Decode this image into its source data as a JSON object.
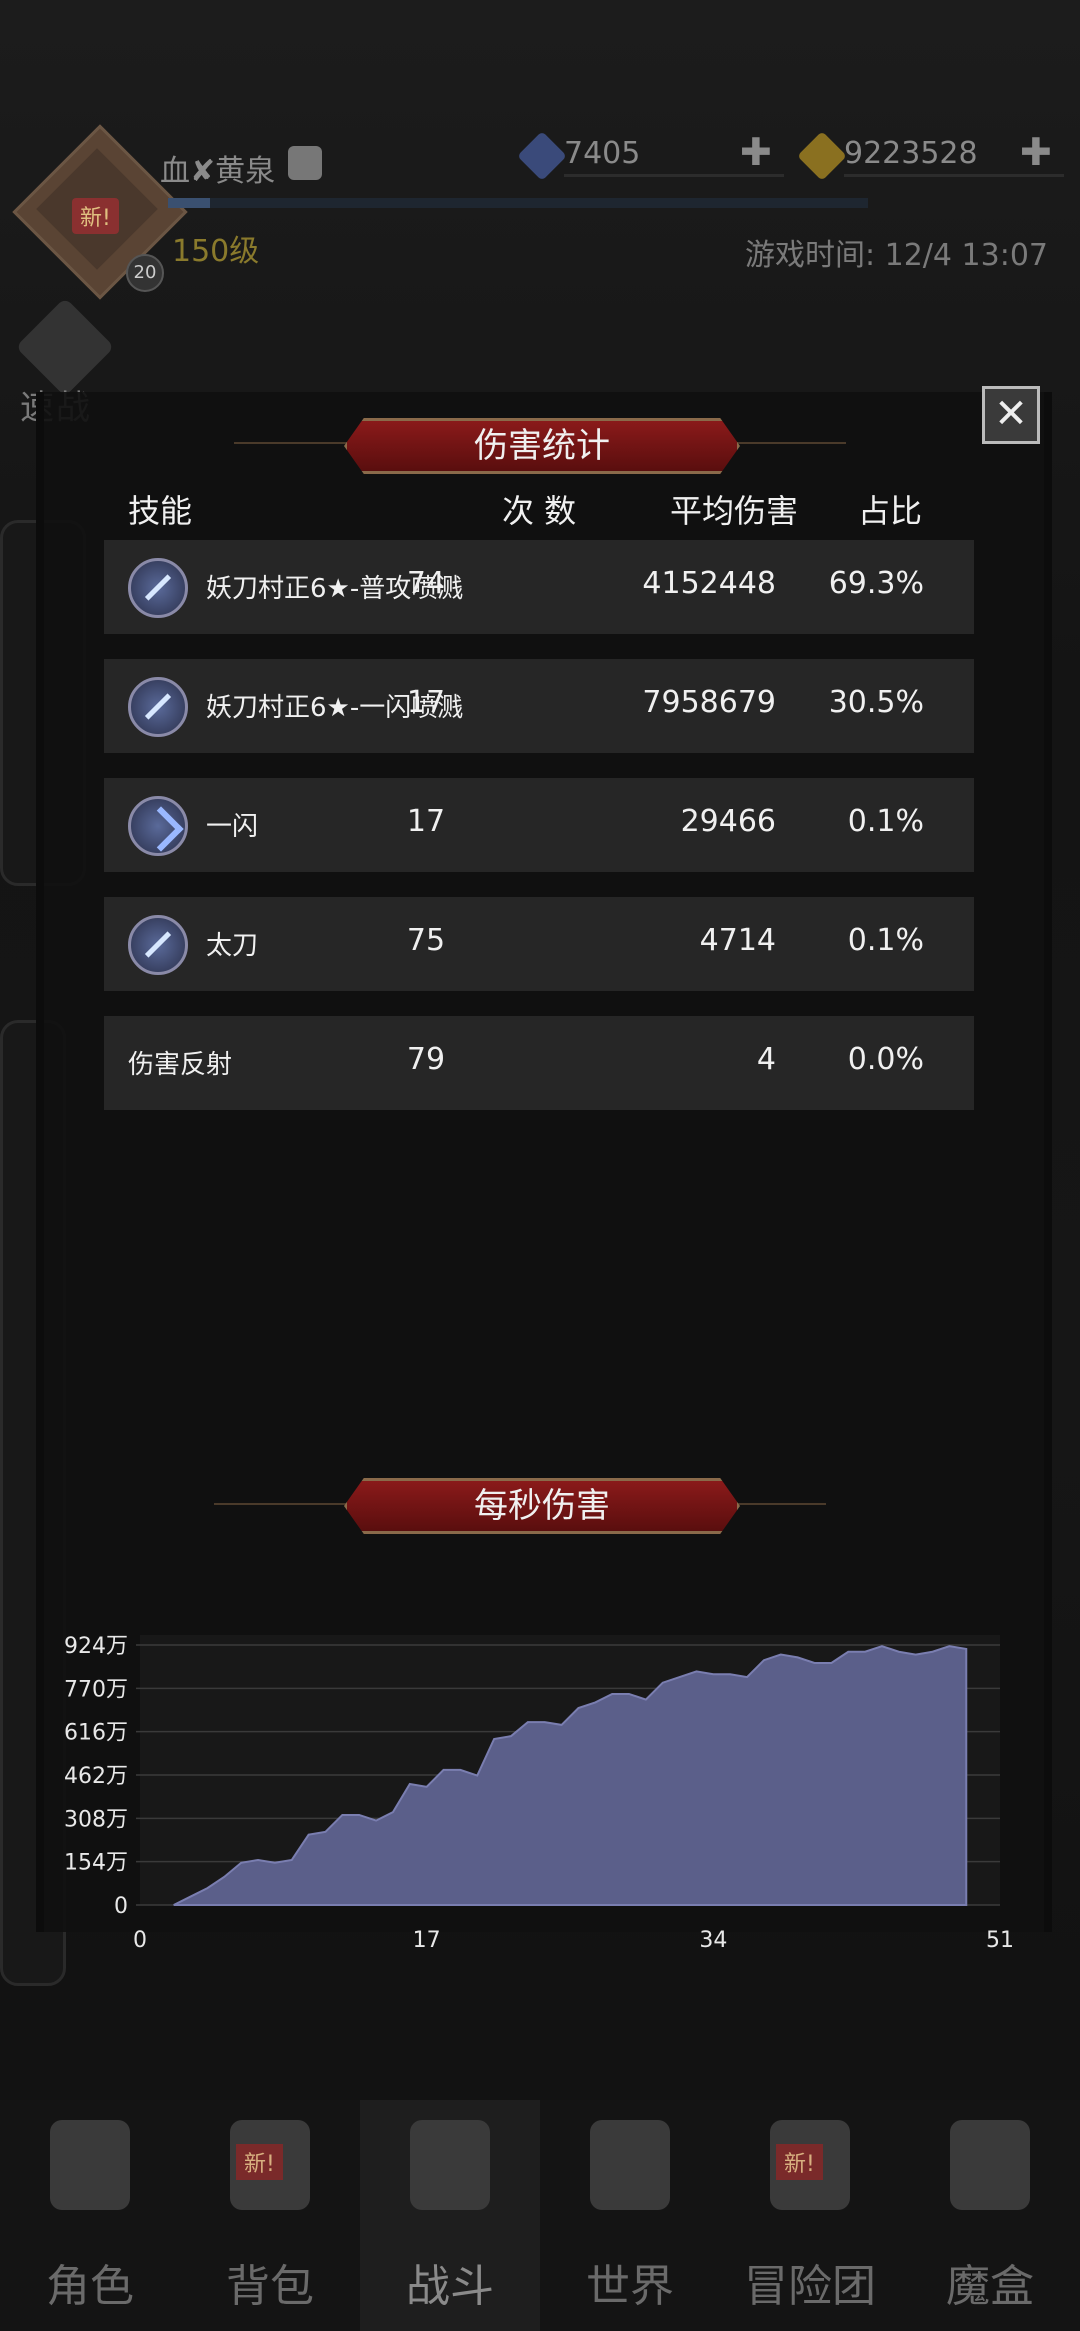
{
  "player": {
    "name": "血✘黄泉",
    "level": "150级",
    "avatar_badge": "新!",
    "avatar_level": "20",
    "exp_progress": 0.06
  },
  "resources": {
    "gems": "7405",
    "gold": "9223528"
  },
  "game_time": "游戏时间: 12/4 13:07",
  "quick_battle_label": "速战",
  "damage_stats": {
    "title": "伤害统计",
    "headers": {
      "skill": "技能",
      "count": "次 数",
      "avg": "平均伤害",
      "ratio": "占比"
    },
    "rows": [
      {
        "icon": "sword-icon",
        "name": "妖刀村正6★-普攻喷溅",
        "count": "74",
        "avg": "4152448",
        "ratio": "69.3%"
      },
      {
        "icon": "sword-icon",
        "name": "妖刀村正6★-一闪喷溅",
        "count": "17",
        "avg": "7958679",
        "ratio": "30.5%"
      },
      {
        "icon": "flash-icon",
        "name": "一闪",
        "count": "17",
        "avg": "29466",
        "ratio": "0.1%"
      },
      {
        "icon": "sword-icon",
        "name": "太刀",
        "count": "75",
        "avg": "4714",
        "ratio": "0.1%"
      },
      {
        "icon": "",
        "name": "伤害反射",
        "count": "79",
        "avg": "4",
        "ratio": "0.0%"
      }
    ]
  },
  "dps": {
    "title": "每秒伤害"
  },
  "chart_data": {
    "type": "area",
    "title": "每秒伤害",
    "xlabel": "",
    "ylabel": "",
    "x_ticks": [
      "0",
      "17",
      "34",
      "51"
    ],
    "y_ticks": [
      "0",
      "154万",
      "308万",
      "462万",
      "616万",
      "770万",
      "924万"
    ],
    "xlim": [
      0,
      51
    ],
    "ylim": [
      0,
      9240000
    ],
    "grid": true,
    "fill_color": "#5b5f8a",
    "x": [
      2,
      3,
      4,
      5,
      6,
      7,
      8,
      9,
      10,
      11,
      12,
      13,
      14,
      15,
      16,
      17,
      18,
      19,
      20,
      21,
      22,
      23,
      24,
      25,
      26,
      27,
      28,
      29,
      30,
      31,
      32,
      33,
      34,
      35,
      36,
      37,
      38,
      39,
      40,
      41,
      42,
      43,
      44,
      45,
      46,
      47,
      48,
      49
    ],
    "values": [
      0,
      300000,
      600000,
      1000000,
      1500000,
      1600000,
      1500000,
      1600000,
      2500000,
      2600000,
      3200000,
      3200000,
      3000000,
      3300000,
      4300000,
      4200000,
      4800000,
      4800000,
      4600000,
      5900000,
      6000000,
      6500000,
      6500000,
      6400000,
      7000000,
      7200000,
      7500000,
      7500000,
      7300000,
      7900000,
      8100000,
      8300000,
      8200000,
      8200000,
      8100000,
      8700000,
      8900000,
      8800000,
      8600000,
      8600000,
      9000000,
      9000000,
      9200000,
      9000000,
      8900000,
      9000000,
      9200000,
      9100000
    ]
  },
  "nav": [
    {
      "label": "角色",
      "badge": ""
    },
    {
      "label": "背包",
      "badge": "新!"
    },
    {
      "label": "战斗",
      "badge": ""
    },
    {
      "label": "世界",
      "badge": ""
    },
    {
      "label": "冒险团",
      "badge": "新!"
    },
    {
      "label": "魔盒",
      "badge": ""
    }
  ]
}
